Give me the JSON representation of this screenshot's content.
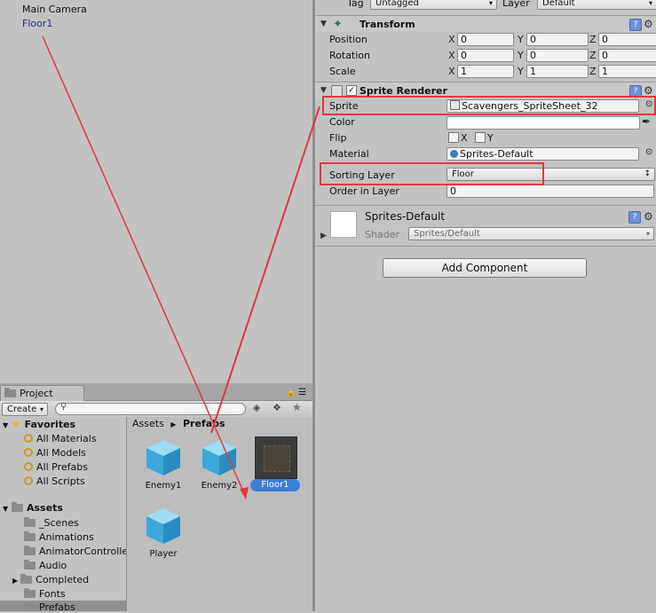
{
  "hierarchy": {
    "items": [
      "Main Camera",
      "Floor1"
    ]
  },
  "inspector": {
    "tag_label": "Tag",
    "tag_value": "Untagged",
    "layer_label": "Layer",
    "layer_value": "Default",
    "transform": {
      "title": "Transform",
      "rows": [
        {
          "label": "Position",
          "x": "0",
          "y": "0",
          "z": "0"
        },
        {
          "label": "Rotation",
          "x": "0",
          "y": "0",
          "z": "0"
        },
        {
          "label": "Scale",
          "x": "1",
          "y": "1",
          "z": "1"
        }
      ],
      "axis_x": "X",
      "axis_y": "Y",
      "axis_z": "Z"
    },
    "sprite_renderer": {
      "title": "Sprite Renderer",
      "sprite_label": "Sprite",
      "sprite_value": "Scavengers_SpriteSheet_32",
      "color_label": "Color",
      "flip_label": "Flip",
      "flip_x": "X",
      "flip_y": "Y",
      "material_label": "Material",
      "material_value": "Sprites-Default",
      "sorting_layer_label": "Sorting Layer",
      "sorting_layer_value": "Floor",
      "order_label": "Order in Layer",
      "order_value": "0"
    },
    "material_section": {
      "name": "Sprites-Default",
      "shader_label": "Shader",
      "shader_value": "Sprites/Default"
    },
    "add_component_label": "Add Component"
  },
  "project": {
    "tab_label": "Project",
    "create_label": "Create",
    "breadcrumb": [
      "Assets",
      "Prefabs"
    ],
    "favorites_label": "Favorites",
    "favorites": [
      "All Materials",
      "All Models",
      "All Prefabs",
      "All Scripts"
    ],
    "assets_label": "Assets",
    "folders": [
      "_Scenes",
      "Animations",
      "AnimatorControlle",
      "Audio",
      "Completed",
      "Fonts",
      "Prefabs"
    ],
    "grid_items": [
      "Enemy1",
      "Enemy2",
      "Floor1",
      "Player"
    ]
  },
  "colors": {
    "highlight": "#e0393e",
    "selection": "#3d7fd9"
  }
}
